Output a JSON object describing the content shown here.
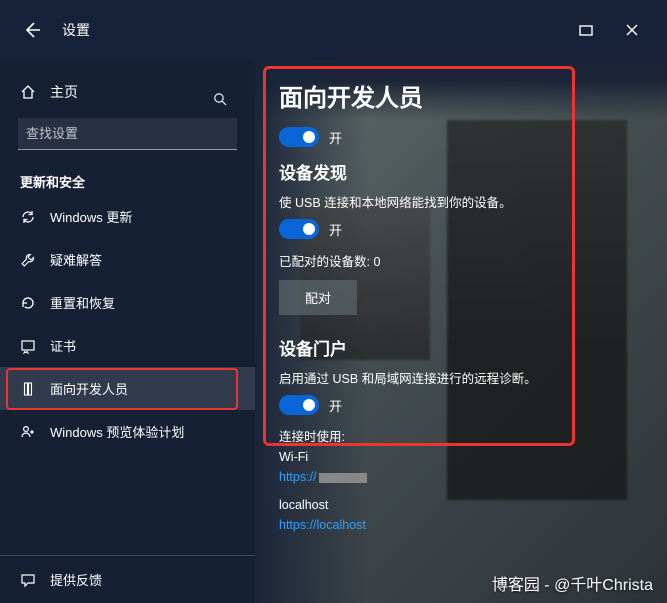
{
  "titlebar": {
    "title": "设置"
  },
  "sidebar": {
    "home": "主页",
    "search_placeholder": "查找设置",
    "section": "更新和安全",
    "items": [
      {
        "label": "Windows 更新"
      },
      {
        "label": "疑难解答"
      },
      {
        "label": "重置和恢复"
      },
      {
        "label": "证书"
      },
      {
        "label": "面向开发人员"
      },
      {
        "label": "Windows 预览体验计划"
      }
    ],
    "feedback": "提供反馈"
  },
  "content": {
    "heading": "面向开发人员",
    "toggle1_state": "开",
    "device_discovery": {
      "title": "设备发现",
      "desc": "使 USB 连接和本地网络能找到你的设备。",
      "state": "开",
      "paired_label": "已配对的设备数: 0",
      "pair_button": "配对"
    },
    "device_portal": {
      "title": "设备门户",
      "desc": "启用通过 USB 和局域网连接进行的远程诊断。",
      "state": "开"
    },
    "connection": {
      "label": "连接时使用:",
      "wifi": "Wi-Fi",
      "wifi_link": "https://",
      "localhost": "localhost",
      "localhost_link": "https://localhost"
    }
  },
  "credit": "博客园 - @千叶Christa"
}
